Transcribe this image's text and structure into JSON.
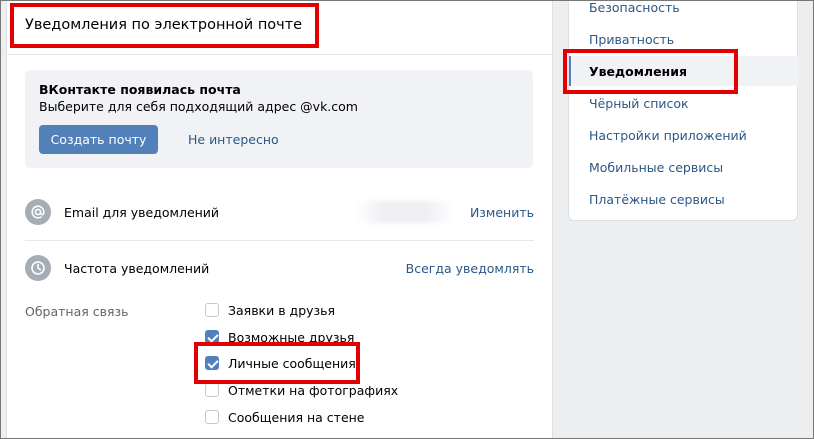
{
  "header": {
    "title": "Уведомления по электронной почте"
  },
  "promo": {
    "title": "ВКонтакте появилась почта",
    "subtitle": "Выберите для себя подходящий адрес @vk.com",
    "create_button": "Создать почту",
    "dismiss_link": "Не интересно"
  },
  "email_row": {
    "label": "Email для уведомлений",
    "action": "Изменить",
    "icon": "at-icon"
  },
  "frequency_row": {
    "label": "Частота уведомлений",
    "action": "Всегда уведомлять",
    "icon": "clock-icon"
  },
  "feedback": {
    "label": "Обратная связь",
    "options": [
      {
        "label": "Заявки в друзья",
        "checked": false
      },
      {
        "label": "Возможные друзья",
        "checked": true
      },
      {
        "label": "Личные сообщения",
        "checked": true
      },
      {
        "label": "Отметки на фотографиях",
        "checked": false
      },
      {
        "label": "Сообщения на стене",
        "checked": false
      }
    ]
  },
  "sidebar": {
    "items": [
      {
        "label": "Безопасность",
        "active": false
      },
      {
        "label": "Приватность",
        "active": false
      },
      {
        "label": "Уведомления",
        "active": true
      },
      {
        "label": "Чёрный список",
        "active": false
      },
      {
        "label": "Настройки приложений",
        "active": false
      },
      {
        "label": "Мобильные сервисы",
        "active": false
      },
      {
        "label": "Платёжные сервисы",
        "active": false
      }
    ]
  },
  "colors": {
    "accent": "#5181b8",
    "link": "#2a5885",
    "highlight": "#e40000",
    "background": "#edeef0"
  }
}
